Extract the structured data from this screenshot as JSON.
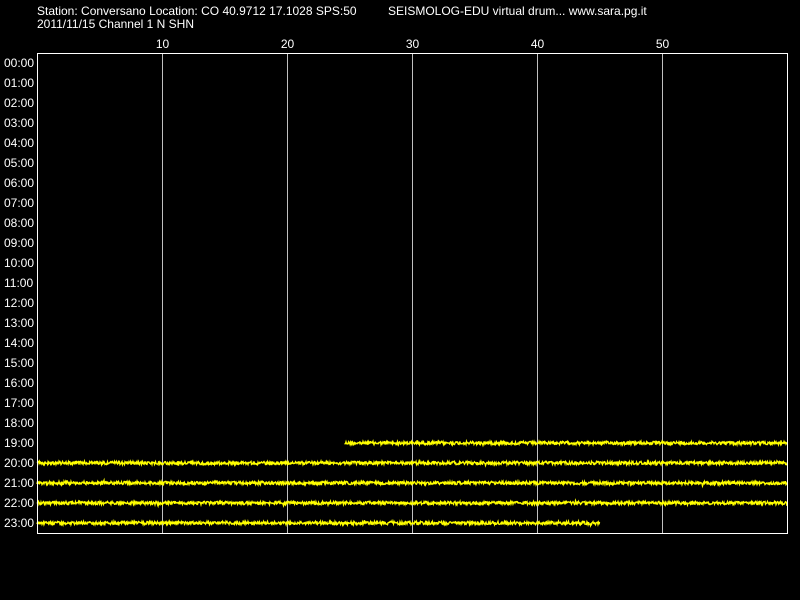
{
  "header": {
    "station_line": "Station: Conversano Location: CO 40.9712 17.1028 SPS:50",
    "brand_line": "SEISMOLOG-EDU virtual drum... www.sara.pg.it",
    "date_line": "2011/11/15  Channel 1 N SHN"
  },
  "colors": {
    "background": "#000000",
    "frame": "#ffffff",
    "gridline": "#c0c0c0",
    "trace": "#ffff00",
    "text": "#ffffff"
  },
  "chart_data": {
    "type": "line",
    "title": "",
    "xlabel": "",
    "ylabel": "",
    "xlim": [
      0,
      60
    ],
    "x_ticks": [
      10,
      20,
      30,
      40,
      50
    ],
    "x_tick_labels": [
      "10",
      "20",
      "30",
      "40",
      "50"
    ],
    "rows": [
      "00:00",
      "01:00",
      "02:00",
      "03:00",
      "04:00",
      "05:00",
      "06:00",
      "07:00",
      "08:00",
      "09:00",
      "10:00",
      "11:00",
      "12:00",
      "13:00",
      "14:00",
      "15:00",
      "16:00",
      "17:00",
      "18:00",
      "19:00",
      "20:00",
      "21:00",
      "22:00",
      "23:00"
    ],
    "grid": "vertical",
    "series": [
      {
        "row": "19:00",
        "start_min": 24.6,
        "end_min": 60
      },
      {
        "row": "20:00",
        "start_min": 0,
        "end_min": 60
      },
      {
        "row": "21:00",
        "start_min": 0,
        "end_min": 60
      },
      {
        "row": "22:00",
        "start_min": 0,
        "end_min": 60
      },
      {
        "row": "23:00",
        "start_min": 0,
        "end_min": 45
      }
    ]
  }
}
